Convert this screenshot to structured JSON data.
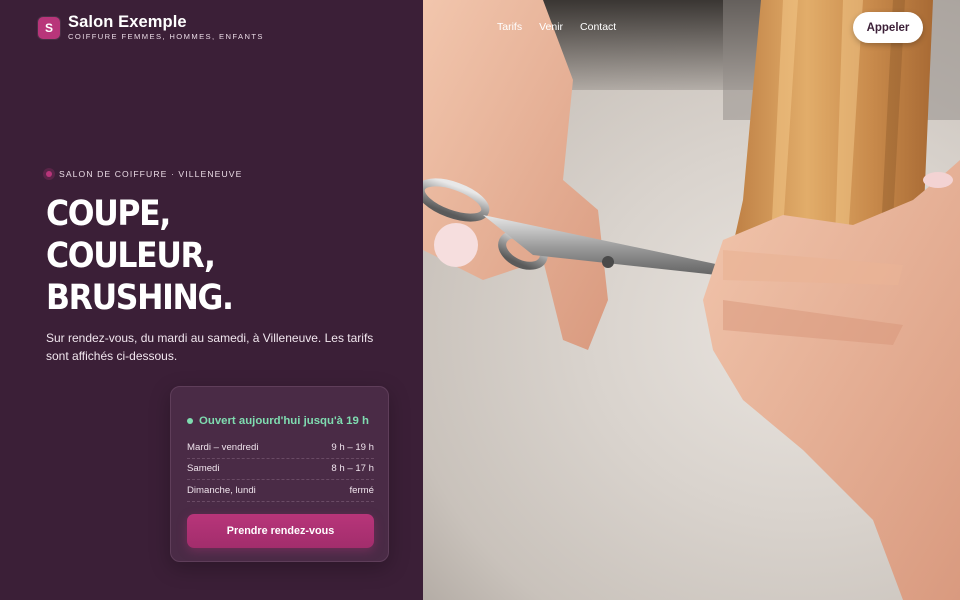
{
  "header": {
    "logo_letter": "S",
    "brand_name": "Salon Exemple",
    "brand_tagline": "COIFFURE FEMMES, HOMMES, ENFANTS",
    "nav": [
      "Tarifs",
      "Venir",
      "Contact"
    ],
    "call_label": "Appeler"
  },
  "hero": {
    "eyebrow": "SALON DE COIFFURE · VILLENEUVE",
    "title_lines": [
      "COUPE,",
      "COULEUR,",
      "BRUSHING."
    ],
    "subtitle": "Sur rendez-vous, du mardi au samedi, à Villeneuve. Les tarifs sont affichés ci-dessous."
  },
  "hours_card": {
    "status": "Ouvert aujourd'hui jusqu'à 19 h",
    "rows": [
      {
        "day": "Mardi – vendredi",
        "hours": "9 h – 19 h"
      },
      {
        "day": "Samedi",
        "hours": "8 h – 17 h"
      },
      {
        "day": "Dimanche, lundi",
        "hours": "fermé"
      }
    ],
    "book_label": "Prendre rendez-vous"
  },
  "colors": {
    "panel": "#3b1f37",
    "accent": "#b8357a",
    "status_green": "#7fdcb0"
  }
}
